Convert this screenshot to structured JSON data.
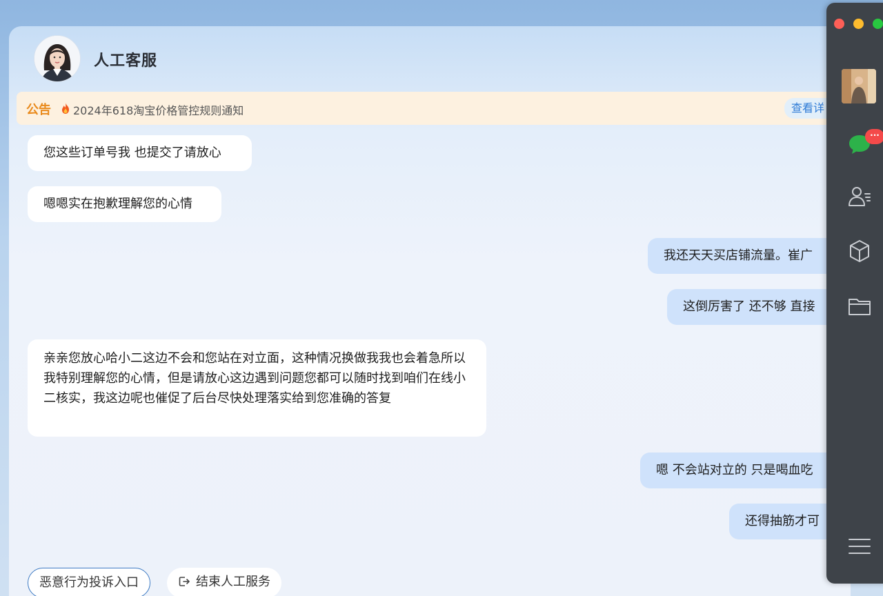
{
  "header": {
    "title": "人工客服"
  },
  "notice": {
    "label": "公告",
    "text": "2024年618淘宝价格管控规则通知",
    "link": "查看详"
  },
  "messages": [
    {
      "side": "left",
      "text": "您这些订单号我 也提交了请放心"
    },
    {
      "side": "left",
      "text": "嗯嗯实在抱歉理解您的心情"
    },
    {
      "side": "right",
      "text": "我还天天买店铺流量。崔广"
    },
    {
      "side": "right",
      "text": "这倒厉害了 还不够 直接"
    },
    {
      "side": "left",
      "text": "亲亲您放心哈小二这边不会和您站在对立面，这种情况换做我我也会着急所以我特别理解您的心情，但是请放心这边遇到问题您都可以随时找到咱们在线小二核实，我这边呢也催促了后台尽快处理落实给到您准确的答复"
    },
    {
      "side": "right",
      "text": "嗯 不会站对立的 只是喝血吃"
    },
    {
      "side": "right",
      "text": "还得抽筋才可"
    }
  ],
  "actions": {
    "complaint": "恶意行为投诉入口",
    "end_service": "结束人工服务"
  },
  "sidebar": {
    "badge": "···",
    "icons": [
      "chat-icon",
      "contacts-icon",
      "cube-icon",
      "folder-icon",
      "menu-icon"
    ]
  },
  "colors": {
    "notice_label": "#e98a1c",
    "link": "#2f7bd6",
    "right_bubble": "#cfe2fb",
    "badge": "#f44a4a",
    "sidebar": "#3e4349"
  }
}
